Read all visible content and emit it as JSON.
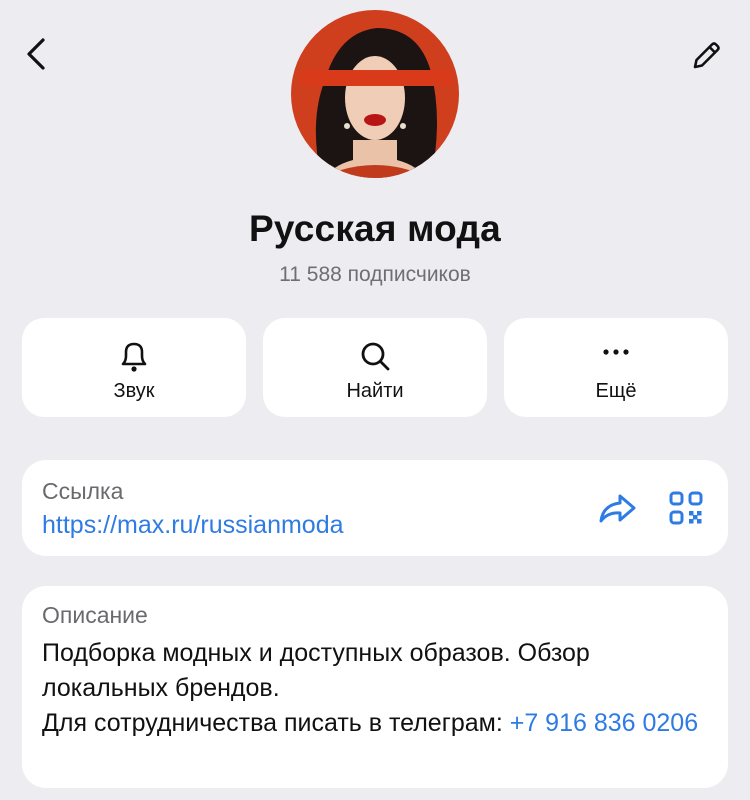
{
  "header": {
    "back_icon": "chevron-left-icon",
    "edit_icon": "pencil-icon"
  },
  "channel": {
    "name": "Русская мода",
    "subscribers": "11 588 подписчиков",
    "avatar_description": "woman with red band over eyes on red-orange background"
  },
  "actions": [
    {
      "label": "Звук",
      "icon": "bell-icon"
    },
    {
      "label": "Найти",
      "icon": "search-icon"
    },
    {
      "label": "Ещё",
      "icon": "more-dots-icon"
    }
  ],
  "link_card": {
    "label": "Ссылка",
    "url": "https://max.ru/russianmoda",
    "share_icon": "share-arrow-icon",
    "qr_icon": "qr-code-icon"
  },
  "description_card": {
    "label": "Описание",
    "text": "Подборка модных и доступных образов. Обзор локальных брендов.",
    "contact_prefix": "Для сотрудничества писать в телеграм: ",
    "phone": "+7 916 836 0206"
  },
  "colors": {
    "background": "#ececf1",
    "accent": "#2f7be4",
    "avatar_bg": "#d0401f"
  }
}
